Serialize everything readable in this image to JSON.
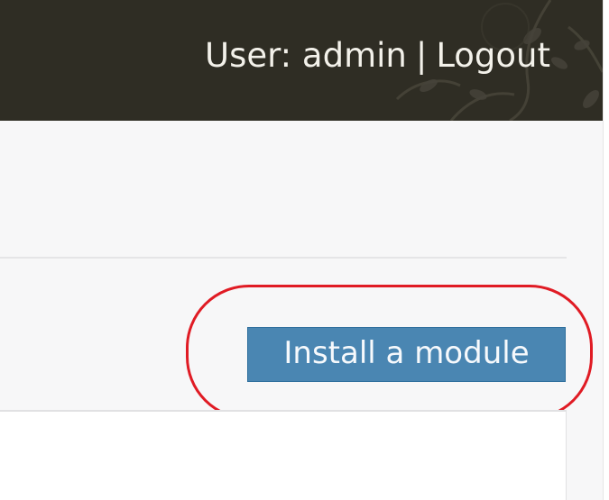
{
  "header": {
    "user_label": "User: admin",
    "separator": "|",
    "logout_label": "Logout"
  },
  "toolbar": {
    "install_module_label": "Install a module"
  },
  "colors": {
    "header_bg": "#2f2d24",
    "button_bg": "#4a86b2",
    "highlight": "#e01b24"
  }
}
